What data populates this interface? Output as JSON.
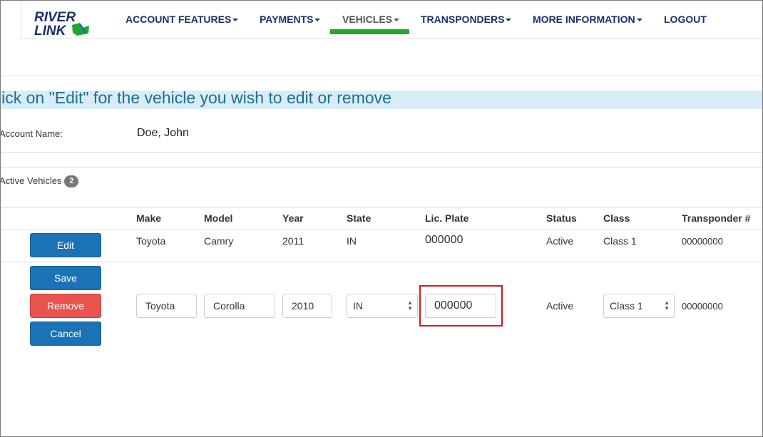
{
  "nav": {
    "logo_line1": "RIVER",
    "logo_line2": "LINK",
    "items": [
      {
        "label": "ACCOUNT FEATURES",
        "has_caret": true
      },
      {
        "label": "PAYMENTS",
        "has_caret": true
      },
      {
        "label": "VEHICLES",
        "has_caret": true,
        "active": true
      },
      {
        "label": "TRANSPONDERS",
        "has_caret": true
      },
      {
        "label": "MORE INFORMATION",
        "has_caret": true
      },
      {
        "label": "LOGOUT",
        "has_caret": false
      }
    ]
  },
  "banner": {
    "text": "lick on \"Edit\" for the vehicle you wish to edit or remove"
  },
  "account": {
    "label": "Account Name:",
    "value": "Doe, John"
  },
  "vehicles": {
    "label": "Active Vehicles",
    "count": "2"
  },
  "table": {
    "headers": [
      "Make",
      "Model",
      "Year",
      "State",
      "Lic. Plate",
      "Status",
      "Class",
      "Transponder #"
    ],
    "row1": {
      "edit_label": "Edit",
      "make": "Toyota",
      "model": "Camry",
      "year": "2011",
      "state": "IN",
      "plate": "000000",
      "status": "Active",
      "class": "Class 1",
      "transponder": "00000000"
    },
    "row2": {
      "save_label": "Save",
      "remove_label": "Remove",
      "cancel_label": "Cancel",
      "make": "Toyota",
      "model": "Corolla",
      "year": "2010",
      "state": "IN",
      "plate": "000000",
      "status": "Active",
      "class": "Class 1",
      "transponder": "00000000"
    }
  },
  "colors": {
    "brand_blue": "#1b2f6b",
    "nav_active_underline": "#1eaa2e",
    "button_blue": "#1b72b5",
    "button_red": "#e85350",
    "highlight_red": "#d9161f",
    "banner_bg": "#d8ecf6"
  }
}
